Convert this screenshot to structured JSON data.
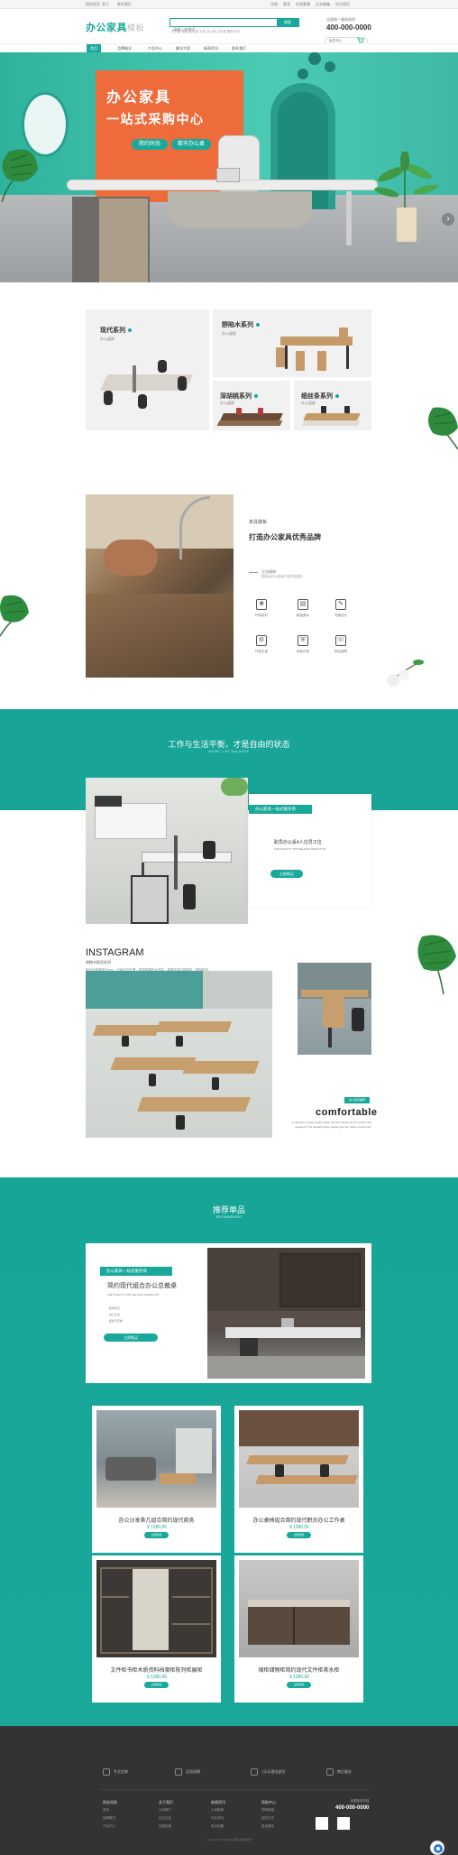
{
  "topbar": {
    "links": [
      "网站首页",
      "关于",
      "联系我们"
    ],
    "right_links": [
      "注册",
      "登录",
      "在线客服",
      "企业邮箱",
      "设为首页"
    ]
  },
  "header": {
    "logo_main": "办公家具",
    "logo_sub": "模板",
    "search_placeholder": "请输入关键词",
    "search_button": "搜索",
    "hot_words": "办公桌  班台  会议桌  沙发  办公椅  文件柜  屏风卡位",
    "hotline_label": "全国统一服务热线",
    "hotline_number": "400-000-0000",
    "account_label": "会员中心",
    "cart_icon": "cart-icon"
  },
  "nav": {
    "items": [
      "首页",
      "品牌概况",
      "产品中心",
      "解决方案",
      "新闻资讯",
      "联系我们"
    ]
  },
  "hero": {
    "line1": "办公家具",
    "line2": "一站式采购中心",
    "btn1": "简约时尚",
    "btn2": "都市办公桌",
    "next_arrow": "›",
    "accent": "#19a99a",
    "poster_color": "#ee6b3b"
  },
  "series": [
    {
      "title": "现代系列",
      "sub": "办公桌屏"
    },
    {
      "title": "野陷木系列",
      "sub": "办公桌屏"
    },
    {
      "title": "深胡桃系列",
      "sub": "办公桌屏"
    },
    {
      "title": "细丝条系列",
      "sub": "办公桌屏"
    }
  ],
  "brand": {
    "label": "家具模板",
    "title": "打造办公家具优秀品牌",
    "sub": "企业精神",
    "sub2": "国际化办公用品产品开发团队",
    "features": [
      "环保用材",
      "精选原木",
      "专属设计",
      "环保五金",
      "绿色环保",
      "售后保障"
    ]
  },
  "balance": {
    "title": "工作与生活平衡，才是自由的状态",
    "subtitle": "WORK LIFE BALANCE",
    "tag": "办公家具一站式服务商",
    "line1": "职员办公桌4人位员工位",
    "line2": "THE TODAY'S TOP SELLING PRODUCTS",
    "button": "立即购买"
  },
  "instagram": {
    "title": "INSTAGRAM",
    "sub": "胡桃木职员系列",
    "desc": "板材台面厚度25mm，边缘封边处理，增强耐磨防水性能，桌脚采用加厚钢材，稳固耐用，多种尺寸可选。",
    "tag": "办公家具推荐",
    "word": "comfortable",
    "desc2": "A collection of high quality office furniture designed for comfort and elegance. The beautiful large panels give the office a fresh look."
  },
  "recommend": {
    "title": "推荐单品",
    "subtitle": "RECOMMENDED",
    "big_tag": "办公家具一站式服务商",
    "big_line1": "简约现代组合办公总裁桌",
    "big_line2": "THE TODAY'S TOP SELLING PRODUCTS",
    "bullets": [
      "· 结构稳定",
      "· 进口五金",
      "· 颜色可定制"
    ],
    "big_button": "立即购买",
    "products": [
      {
        "name": "办公沙发茶几组合简约现代商务",
        "price": "￥1280.00",
        "button": "立即购买"
      },
      {
        "name": "办公桌椅组合简约现代职员办公工作桌",
        "price": "￥1280.00",
        "button": "立即购买"
      },
      {
        "name": "文件柜书柜木质资料档案柜陈列柜展柜",
        "price": "￥1280.00",
        "button": "立即购买"
      },
      {
        "name": "矮柜储物柜简约现代文件柜茶水柜",
        "price": "￥1280.00",
        "button": "立即购买"
      }
    ]
  },
  "footer": {
    "services": [
      "专业定制",
      "品质保障",
      "7天无理由退货",
      "售后服务"
    ],
    "columns": [
      {
        "head": "网站导航",
        "items": [
          "首页",
          "品牌概况",
          "产品中心"
        ]
      },
      {
        "head": "关于我们",
        "items": [
          "公司简介",
          "企业文化",
          "发展历程"
        ]
      },
      {
        "head": "新闻资讯",
        "items": [
          "公司新闻",
          "行业资讯",
          "常见问题"
        ]
      },
      {
        "head": "帮助中心",
        "items": [
          "购物指南",
          "配送方式",
          "售后服务"
        ]
      }
    ],
    "contact_label": "全国服务热线",
    "contact_number": "400-000-0000",
    "copyright": "Copyright © 2020 办公家具 版权所有"
  }
}
